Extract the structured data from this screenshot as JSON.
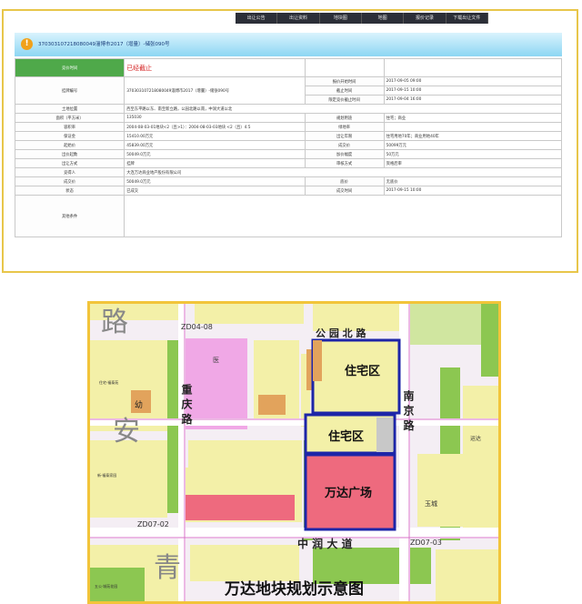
{
  "nav": [
    "出让公告",
    "出让资料",
    "地块图",
    "地图",
    "报价记录",
    "下载出让文件"
  ],
  "title": "370303107218080049淄博市2017（增量）-储张090号",
  "status_label": "竞价时间",
  "status_value": "已经截止",
  "rows": [
    {
      "l1": "挂牌编号",
      "v1": "370303107218080049淄博市2017（增量）-储张090号",
      "times": [
        [
          "报价开始时间",
          "2017-09-05 09:00"
        ],
        [
          "截止时间",
          "2017-09-15 10:00"
        ],
        [
          "限定竞价截止时间",
          "2017-09-04 16:00"
        ]
      ]
    },
    {
      "l1": "土地位置",
      "v1": "西至东平路以东、南至新立路，公园北路以南，中润大道以北",
      "l2": "",
      "v2": ""
    },
    {
      "l1": "面积（平方米）",
      "v1": "135030",
      "l2": "规划用途",
      "v2": "住宅；商业"
    },
    {
      "l1": "容积率",
      "v1": "2004-08-03-01地块<2（且>1）：2004-08-03-03地块 <2（且）4.5",
      "l2": "绿地率",
      "v2": ""
    },
    {
      "l1": "保证金",
      "v1": "15410.00万元",
      "l2": "出让年限",
      "v2": "住宅用地70年；商业用地40年"
    },
    {
      "l1": "起始价",
      "v1": "45839.00万元",
      "l2": "成交价",
      "v2": "50099万元"
    },
    {
      "l1": "出价起数",
      "v1": "50049.0万元",
      "l2": "加价幅度",
      "v2": "50万元"
    },
    {
      "l1": "出让方式",
      "v1": "挂牌",
      "l2": "审核方式",
      "v2": "资格后审"
    },
    {
      "l1": "竞得人",
      "v1": "大连万达商业地产股份有限公司",
      "l2": "",
      "v2": ""
    },
    {
      "l1": "成交价",
      "v1": "50049.0万元",
      "l2": "底价",
      "v2": "无底价"
    },
    {
      "l1": "状态",
      "v1": "已成交",
      "l2": "成交时间",
      "v2": "2017-09-15 10:00"
    },
    {
      "l1": "其他条件",
      "v1": "",
      "l2": "",
      "v2": ""
    }
  ],
  "map": {
    "title": "万达地块规划示意图",
    "zone_residential_1": "住宅区",
    "zone_residential_2": "住宅区",
    "zone_commercial": "万达广场",
    "road_gongyuan": "公 园 北 路",
    "road_nanjing": "南 京 路",
    "road_chongqing": "重 庆 路",
    "road_zhongrun": "中 润 大 道",
    "road_lu_big": "路",
    "road_an_big": "安",
    "road_qing_big": "青",
    "code_1": "ZD04-08",
    "code_2": "ZD07-02",
    "code_3": "ZD07-03",
    "lbl_you": "幼",
    "lbl_yi": "医",
    "lbl_yucheng": "玉城",
    "lbl_a": "住宅·福泰苑",
    "lbl_b": "新·福泰家园",
    "lbl_c": "五公·城苑花园",
    "lbl_d": "运达"
  }
}
